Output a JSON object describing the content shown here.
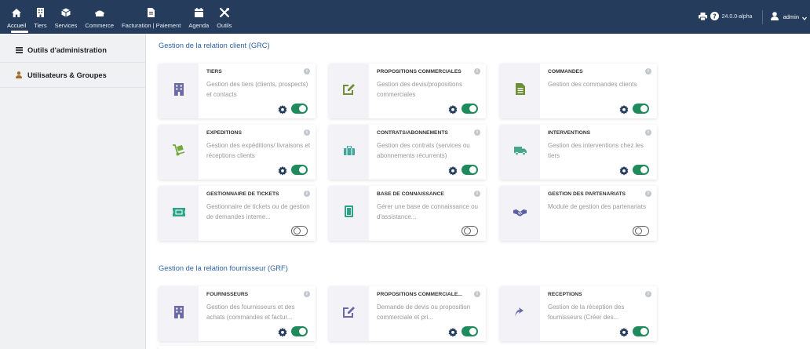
{
  "topbar": {
    "menu": [
      {
        "label": "Accueil",
        "icon": "home-icon"
      },
      {
        "label": "Tiers",
        "icon": "building-icon"
      },
      {
        "label": "Services",
        "icon": "cube-icon"
      },
      {
        "label": "Commerce",
        "icon": "briefcase-icon"
      },
      {
        "label": "Facturation | Paiement",
        "icon": "invoice-icon"
      },
      {
        "label": "Agenda",
        "icon": "calendar-icon"
      },
      {
        "label": "Outils",
        "icon": "tools-icon"
      }
    ],
    "version": "24.0.0-alpha",
    "user": "admin"
  },
  "sidebar": {
    "items": [
      {
        "label": "Outils d'administration",
        "icon": "list-icon"
      },
      {
        "label": "Utilisateurs & Groupes",
        "icon": "user-icon"
      }
    ]
  },
  "sections": [
    {
      "title": "Gestion de la relation client (GRC)",
      "cards": [
        {
          "title": "TIERS",
          "desc": "Gestion des tiers (clients, prospects) et contacts",
          "icon": "building-icon",
          "enabled": true,
          "has_setup": true
        },
        {
          "title": "PROPOSITIONS COMMERCIALES",
          "desc": "Gestion des devis/propositions commerciales",
          "icon": "proposal-icon",
          "enabled": true,
          "has_setup": true
        },
        {
          "title": "COMMANDES",
          "desc": "Gestion des commandes clients",
          "icon": "order-icon",
          "enabled": true,
          "has_setup": true
        },
        {
          "title": "EXPÉDITIONS",
          "desc": "Gestion des expéditions/ livraisons et réceptions clients",
          "icon": "dolly-icon",
          "enabled": true,
          "has_setup": true
        },
        {
          "title": "CONTRATS/ABONNEMENTS",
          "desc": "Gestion des contrats (services ou abonnements récurrents)",
          "icon": "suitcase-icon",
          "enabled": true,
          "has_setup": true
        },
        {
          "title": "INTERVENTIONS",
          "desc": "Gestion des interventions chez les tiers",
          "icon": "truck-icon",
          "enabled": true,
          "has_setup": true
        },
        {
          "title": "GESTIONNAIRE DE TICKETS",
          "desc": "Gestionnaire de tickets ou de gestion de demandes interne...",
          "icon": "ticket-icon",
          "enabled": false,
          "has_setup": false
        },
        {
          "title": "BASE DE CONNAISSANCE",
          "desc": "Gérer une base de connaissance ou d'assistance...",
          "icon": "book-icon",
          "enabled": false,
          "has_setup": false
        },
        {
          "title": "GESTION DES PARTENARIATS",
          "desc": "Module de gestion des partenariats",
          "icon": "handshake-icon",
          "enabled": false,
          "has_setup": false
        }
      ]
    },
    {
      "title": "Gestion de la relation fournisseur (GRF)",
      "cards": [
        {
          "title": "FOURNISSEURS",
          "desc": "Gestion des fournisseurs et des achats (commandes et factur...",
          "icon": "building-icon",
          "enabled": true,
          "has_setup": true
        },
        {
          "title": "PROPOSITIONS COMMERCIALE...",
          "desc": "Demande de devis ou proposition commerciale et pri...",
          "icon": "proposal-icon",
          "enabled": true,
          "has_setup": true
        },
        {
          "title": "RÉCEPTIONS",
          "desc": "Gestion de la réception des fournisseurs (Créer des...",
          "icon": "reception-icon",
          "enabled": true,
          "has_setup": true
        }
      ]
    }
  ],
  "colors": {
    "topbar": "#263c5c",
    "accent": "#2f63a3",
    "toggle_on": "#1f8a5c",
    "toggle_off": "#5e5e5e",
    "gear": "#263c5c",
    "icon_companies": "#6b6aa6",
    "icon_commerce": "#6d8f36",
    "icon_shipping": "#73a93a",
    "icon_contracts": "#44a59a",
    "icon_interventions": "#45a68a",
    "icon_ticket": "#2ea38a",
    "icon_partners": "#5c5fa6"
  }
}
